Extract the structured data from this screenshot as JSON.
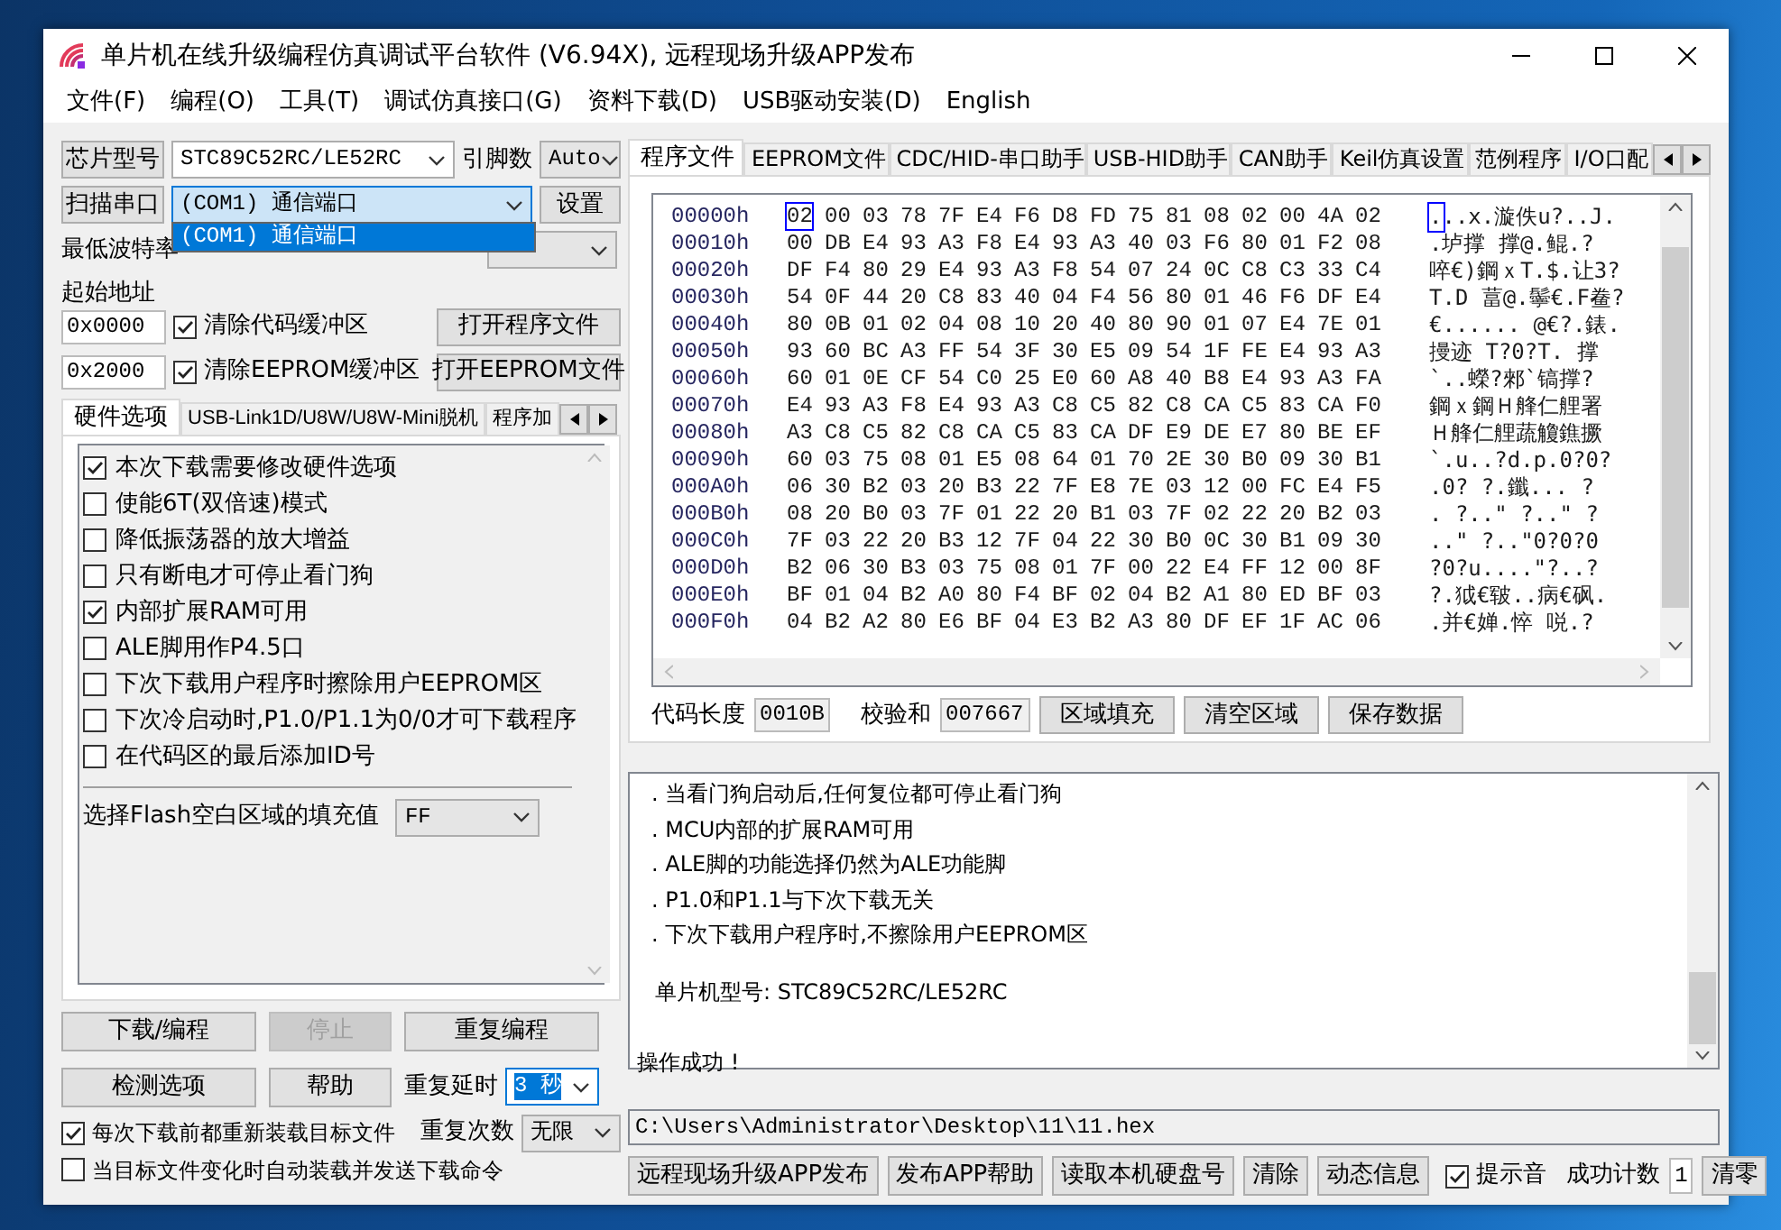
{
  "window": {
    "title": "单片机在线升级编程仿真调试平台软件 (V6.94X), 远程现场升级APP发布"
  },
  "menu": [
    "文件(F)",
    "编程(O)",
    "工具(T)",
    "调试仿真接口(G)",
    "资料下载(D)",
    "USB驱动安装(D)",
    "English"
  ],
  "chip_row": {
    "button": "芯片型号",
    "chip": "STC89C52RC/LE52RC",
    "pins_label": "引脚数",
    "pins": "Auto"
  },
  "port_row": {
    "button": "扫描串口",
    "port": "(COM1) 通信端口",
    "settings_button": "设置",
    "dropdown_open": true,
    "options": [
      {
        "label": "(COM1) 通信端口",
        "selected": true
      }
    ]
  },
  "baud_row": {
    "min_label": "最低波特率"
  },
  "address": {
    "label": "起始地址",
    "rows": [
      {
        "value": "0x0000",
        "checkbox": "清除代码缓冲区",
        "checked": true,
        "button": "打开程序文件"
      },
      {
        "value": "0x2000",
        "checkbox": "清除EEPROM缓冲区",
        "checked": true,
        "button": "打开EEPROM文件"
      }
    ]
  },
  "left_tabs": [
    {
      "label": "硬件选项",
      "selected": true
    },
    {
      "label": "USB-Link1D/U8W/U8W-Mini脱机",
      "selected": false
    },
    {
      "label": "程序加",
      "selected": false
    }
  ],
  "hardware_options": [
    {
      "label": "本次下载需要修改硬件选项",
      "checked": true
    },
    {
      "label": "使能6T(双倍速)模式",
      "checked": false
    },
    {
      "label": "降低振荡器的放大增益",
      "checked": false
    },
    {
      "label": "只有断电才可停止看门狗",
      "checked": false
    },
    {
      "label": "内部扩展RAM可用",
      "checked": true
    },
    {
      "label": "ALE脚用作P4.5口",
      "checked": false
    },
    {
      "label": "下次下载用户程序时擦除用户EEPROM区",
      "checked": false
    },
    {
      "label": "下次冷启动时,P1.0/P1.1为0/0才可下载程序",
      "checked": false
    },
    {
      "label": "在代码区的最后添加ID号",
      "checked": false
    }
  ],
  "fill_value": {
    "label": "选择Flash空白区域的填充值",
    "value": "FF"
  },
  "left_buttons": [
    {
      "label": "下载/编程",
      "disabled": false
    },
    {
      "label": "停止",
      "disabled": true
    },
    {
      "label": "重复编程",
      "disabled": false
    },
    {
      "label": "检测选项",
      "disabled": false
    },
    {
      "label": "帮助",
      "disabled": false
    }
  ],
  "repeat": [
    {
      "label": "重复延时",
      "value": "3 秒",
      "highlighted": true
    },
    {
      "label": "重复次数",
      "value": "无限",
      "highlighted": false
    }
  ],
  "reload_options": [
    {
      "label": "每次下载前都重新装载目标文件",
      "checked": true
    },
    {
      "label": "当目标文件变化时自动装载并发送下载命令",
      "checked": false
    }
  ],
  "right_tabs": [
    {
      "label": "程序文件",
      "selected": true
    },
    {
      "label": "EEPROM文件",
      "selected": false
    },
    {
      "label": "CDC/HID-串口助手",
      "selected": false
    },
    {
      "label": "USB-HID助手",
      "selected": false
    },
    {
      "label": "CAN助手",
      "selected": false
    },
    {
      "label": "Keil仿真设置",
      "selected": false
    },
    {
      "label": "范例程序",
      "selected": false
    },
    {
      "label": "I/O口配",
      "selected": false
    }
  ],
  "hex": {
    "rows": [
      {
        "address": "00000h",
        "bytes": [
          "02",
          "00",
          "03",
          "78",
          "7F",
          "E4",
          "F6",
          "D8",
          "FD",
          "75",
          "81",
          "08",
          "02",
          "00",
          "4A",
          "02"
        ],
        "ascii": "...x.漩佚u?..J.",
        "cursor": true
      },
      {
        "address": "00010h",
        "bytes": [
          "00",
          "DB",
          "E4",
          "93",
          "A3",
          "F8",
          "E4",
          "93",
          "A3",
          "40",
          "03",
          "F6",
          "80",
          "01",
          "F2",
          "08"
        ],
        "ascii": ".垆撑  撑@.鲲.?",
        "cursor": false
      },
      {
        "address": "00020h",
        "bytes": [
          "DF",
          "F4",
          "80",
          "29",
          "E4",
          "93",
          "A3",
          "F8",
          "54",
          "07",
          "24",
          "0C",
          "C8",
          "C3",
          "33",
          "C4"
        ],
        "ascii": "啐€)鋼ｘT.$.让3?",
        "cursor": false
      },
      {
        "address": "00030h",
        "bytes": [
          "54",
          "0F",
          "44",
          "20",
          "C8",
          "83",
          "40",
          "04",
          "F4",
          "56",
          "80",
          "01",
          "46",
          "F6",
          "DF",
          "E4"
        ],
        "ascii": "T.D 葍@.鬡€.F鲞?",
        "cursor": false
      },
      {
        "address": "00040h",
        "bytes": [
          "80",
          "0B",
          "01",
          "02",
          "04",
          "08",
          "10",
          "20",
          "40",
          "80",
          "90",
          "01",
          "07",
          "E4",
          "7E",
          "01"
        ],
        "ascii": "€...... @€?.錶.",
        "cursor": false
      },
      {
        "address": "00050h",
        "bytes": [
          "93",
          "60",
          "BC",
          "A3",
          "FF",
          "54",
          "3F",
          "30",
          "E5",
          "09",
          "54",
          "1F",
          "FE",
          "E4",
          "93",
          "A3"
        ],
        "ascii": "摱迹  T?0?T.  撑",
        "cursor": false
      },
      {
        "address": "00060h",
        "bytes": [
          "60",
          "01",
          "0E",
          "CF",
          "54",
          "C0",
          "25",
          "E0",
          "60",
          "A8",
          "40",
          "B8",
          "E4",
          "93",
          "A3",
          "FA"
        ],
        "ascii": "`..蠑?郲`镐撑?",
        "cursor": false
      },
      {
        "address": "00070h",
        "bytes": [
          "E4",
          "93",
          "A3",
          "F8",
          "E4",
          "93",
          "A3",
          "C8",
          "C5",
          "82",
          "C8",
          "CA",
          "C5",
          "83",
          "CA",
          "F0"
        ],
        "ascii": "鋼ｘ鋼Ｈ艂仁艃署",
        "cursor": false
      },
      {
        "address": "00080h",
        "bytes": [
          "A3",
          "C8",
          "C5",
          "82",
          "C8",
          "CA",
          "C5",
          "83",
          "CA",
          "DF",
          "E9",
          "DE",
          "E7",
          "80",
          "BE",
          "EF"
        ],
        "ascii": "Ｈ艂仁艃蔬觼鐎撅",
        "cursor": false
      },
      {
        "address": "00090h",
        "bytes": [
          "60",
          "03",
          "75",
          "08",
          "01",
          "E5",
          "08",
          "64",
          "01",
          "70",
          "2E",
          "30",
          "B0",
          "09",
          "30",
          "B1"
        ],
        "ascii": "`.u..?d.p.0?0?",
        "cursor": false
      },
      {
        "address": "000A0h",
        "bytes": [
          "06",
          "30",
          "B2",
          "03",
          "20",
          "B3",
          "22",
          "7F",
          "E8",
          "7E",
          "03",
          "12",
          "00",
          "FC",
          "E4",
          "F5"
        ],
        "ascii": ".0? ?.鑯...  ?",
        "cursor": false
      },
      {
        "address": "000B0h",
        "bytes": [
          "08",
          "20",
          "B0",
          "03",
          "7F",
          "01",
          "22",
          "20",
          "B1",
          "03",
          "7F",
          "02",
          "22",
          "20",
          "B2",
          "03"
        ],
        "ascii": ". ?..\" ?..\" ?",
        "cursor": false
      },
      {
        "address": "000C0h",
        "bytes": [
          "7F",
          "03",
          "22",
          "20",
          "B3",
          "12",
          "7F",
          "04",
          "22",
          "30",
          "B0",
          "0C",
          "30",
          "B1",
          "09",
          "30"
        ],
        "ascii": "..\" ?..\"0?0?0",
        "cursor": false
      },
      {
        "address": "000D0h",
        "bytes": [
          "B2",
          "06",
          "30",
          "B3",
          "03",
          "75",
          "08",
          "01",
          "7F",
          "00",
          "22",
          "E4",
          "FF",
          "12",
          "00",
          "8F"
        ],
        "ascii": "?0?u....\"?..?",
        "cursor": false
      },
      {
        "address": "000E0h",
        "bytes": [
          "BF",
          "01",
          "04",
          "B2",
          "A0",
          "80",
          "F4",
          "BF",
          "02",
          "04",
          "B2",
          "A1",
          "80",
          "ED",
          "BF",
          "03"
        ],
        "ascii": "?.狘€皲..病€砜.",
        "cursor": false
      },
      {
        "address": "000F0h",
        "bytes": [
          "04",
          "B2",
          "A2",
          "80",
          "E6",
          "BF",
          "04",
          "E3",
          "B2",
          "A3",
          "80",
          "DF",
          "EF",
          "1F",
          "AC",
          "06"
        ],
        "ascii": ".并€婵.悴  哾.?",
        "cursor": false
      }
    ]
  },
  "code_info": {
    "length_label": "代码长度",
    "length": "0010B",
    "checksum_label": "校验和",
    "checksum": "007667",
    "buttons": [
      "区域填充",
      "清空区域",
      "保存数据"
    ]
  },
  "log": {
    "lines": [
      {
        "kind": "item",
        "text": ". 当看门狗启动后,任何复位都可停止看门狗"
      },
      {
        "kind": "item",
        "text": ". MCU内部的扩展RAM可用"
      },
      {
        "kind": "item",
        "text": ". ALE脚的功能选择仍然为ALE功能脚"
      },
      {
        "kind": "item",
        "text": ". P1.0和P1.1与下次下载无关"
      },
      {
        "kind": "item",
        "text": ". 下次下载用户程序时,不擦除用户EEPROM区"
      },
      {
        "kind": "info",
        "text": "单片机型号: STC89C52RC/LE52RC"
      },
      {
        "kind": "result",
        "text": "操作成功 !"
      }
    ]
  },
  "path": "C:\\Users\\Administrator\\Desktop\\11\\11.hex",
  "bottom_bar": {
    "buttons": [
      "远程现场升级APP发布",
      "发布APP帮助",
      "读取本机硬盘号",
      "清除",
      "动态信息"
    ],
    "sound": {
      "label": "提示音",
      "checked": true
    },
    "count_label": "成功计数",
    "count": "1",
    "reset_button": "清零"
  }
}
